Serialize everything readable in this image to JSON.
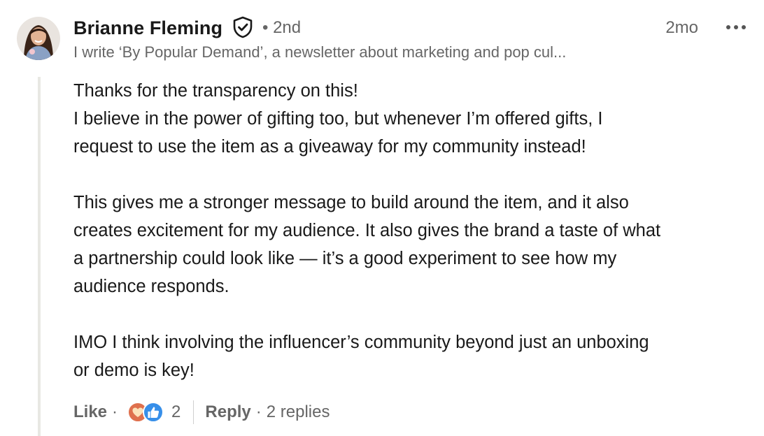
{
  "author": {
    "name": "Brianne Fleming",
    "degree": "• 2nd",
    "headline": "I write ‘By Popular Demand’, a newsletter about marketing and pop cul...",
    "timestamp": "2mo",
    "avatar_icon": "profile-photo",
    "verified_icon": "verified-shield-icon",
    "more_icon": "more-options-icon"
  },
  "comment": {
    "paragraphs": [
      [
        "Thanks for the transparency on this!",
        "I believe in the power of gifting too, but whenever I’m offered gifts, I",
        "request to use the item as a giveaway for my community instead!"
      ],
      [
        "This gives me a stronger message to build around the item, and it also",
        "creates excitement for my audience. It also gives the brand a taste of what",
        "a partnership could look like — it’s a good experiment to see how my",
        "audience responds."
      ],
      [
        "IMO I think involving the influencer’s community beyond just an unboxing",
        "or demo is key!"
      ]
    ]
  },
  "actions": {
    "like_label": "Like",
    "separator_dot": "·",
    "reaction_icons": [
      "love-reaction-icon",
      "like-reaction-icon"
    ],
    "reaction_count": "2",
    "reply_label": "Reply",
    "replies_count": "2 replies"
  },
  "colors": {
    "text_primary": "#191919",
    "text_secondary": "#666666",
    "like_blue": "#378fe9",
    "love_red": "#df704d",
    "thread_line": "#e8e8e3"
  }
}
